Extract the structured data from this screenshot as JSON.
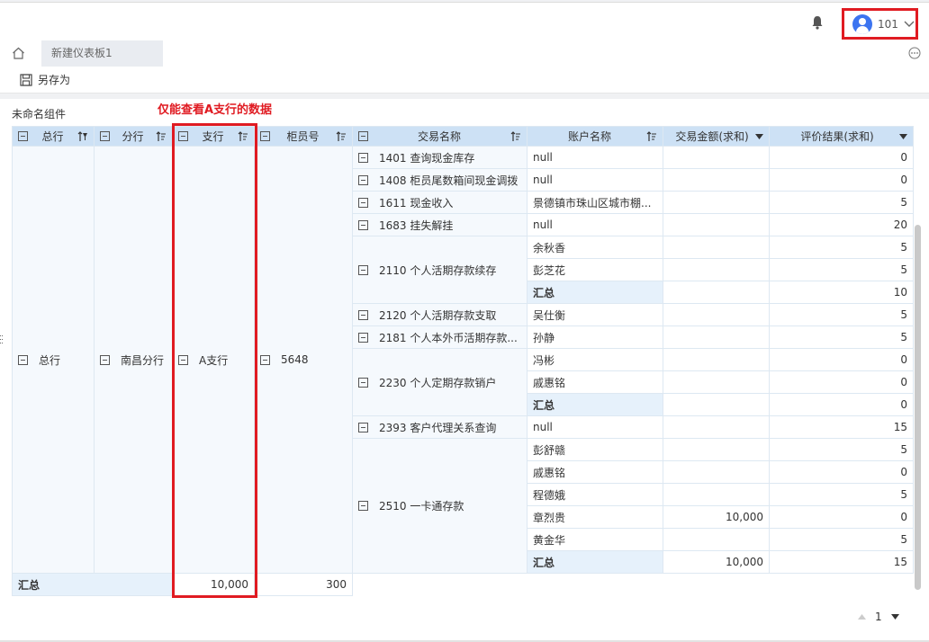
{
  "header": {
    "user": {
      "name": "101"
    },
    "icons": {
      "notification": "bell-icon",
      "user": "avatar-icon",
      "menu": "chevron-down-icon"
    }
  },
  "tabs": [
    {
      "label": "新建仪表板1",
      "active": true
    }
  ],
  "toolbar": {
    "save_as_label": "另存为"
  },
  "widget": {
    "title": "未命名组件",
    "annotation": "仅能查看A支行的数据",
    "headers": {
      "head_office": "总行",
      "branch": "分行",
      "sub_branch": "支行",
      "teller": "柜员号",
      "trade_name": "交易名称",
      "account_name": "账户名称",
      "amount": "交易金额(求和)",
      "rating": "评价结果(求和)"
    },
    "dims": {
      "head_office": "总行",
      "branch": "南昌分行",
      "sub_branch": "A支行",
      "teller": "5648"
    },
    "rows": {
      "t1401": "1401 查询现金库存",
      "t1408": "1408 柜员尾数箱间现金调拨",
      "t1611": "1611 现金收入",
      "t1683": "1683 挂失解挂",
      "t2110": "2110 个人活期存款续存",
      "t2120": "2120 个人活期存款支取",
      "t2181": "2181 个人本外币活期存款...",
      "t2230": "2230 个人定期存款销户",
      "t2393": "2393 客户代理关系查询",
      "t2510": "2510 一卡通存款",
      "a_null": "null",
      "a_jingdezhen": "景德镇市珠山区城市棚...",
      "a_yu": "余秋香",
      "a_peng_zh": "彭芝花",
      "a_wu": "吴仕衡",
      "a_sun": "孙静",
      "a_feng": "冯彬",
      "a_qi": "戚惠铭",
      "a_peng_sg": "彭舒赣",
      "a_cheng": "程德娥",
      "a_zhang": "章烈贵",
      "a_huang": "黄金华",
      "subtotal": "汇总",
      "total": "汇总"
    },
    "values": {
      "r1401": "0",
      "r1408": "0",
      "r1611": "5",
      "r1683": "20",
      "r2110_yu": "5",
      "r2110_peng": "5",
      "r2110_sub": "10",
      "r2120": "5",
      "r2181": "5",
      "r2230_feng": "0",
      "r2230_qi": "0",
      "r2230_sub": "0",
      "r2393": "15",
      "r2510_peng": "5",
      "r2510_qi": "0",
      "r2510_cheng": "5",
      "r2510_zhang": "0",
      "r2510_huang": "5",
      "amt_2510_zhang": "10,000",
      "amt_2510_sub": "10,000",
      "r2510_sub": "15",
      "amt_total": "10,000",
      "r_total": "300"
    },
    "pager": {
      "page": "1"
    }
  },
  "colors": {
    "highlight": "#e01b22",
    "header_bg": "#cde1f5",
    "avatar": "#3c74f0"
  }
}
